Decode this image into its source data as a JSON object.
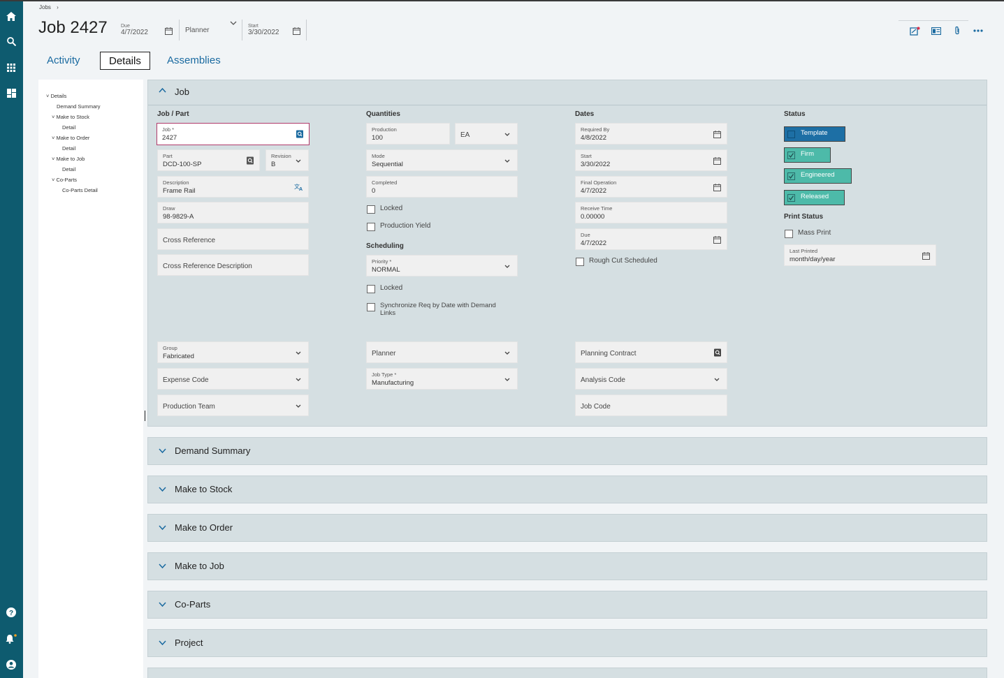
{
  "breadcrumb": {
    "root": "Jobs",
    "separator": "›"
  },
  "header": {
    "title": "Job 2427",
    "due_label": "Due",
    "due_value": "4/7/2022",
    "planner_label": "Planner",
    "start_label": "Start",
    "start_value": "3/30/2022"
  },
  "tabs": [
    {
      "label": "Activity"
    },
    {
      "label": "Details"
    },
    {
      "label": "Assemblies"
    }
  ],
  "tree": {
    "details": "Details",
    "demand_summary": "Demand Summary",
    "make_to_stock": "Make to Stock",
    "mts_detail": "Detail",
    "make_to_order": "Make to Order",
    "mto_detail": "Detail",
    "make_to_job": "Make to Job",
    "mtj_detail": "Detail",
    "co_parts": "Co-Parts",
    "co_parts_detail": "Co-Parts Detail"
  },
  "job_panel": {
    "title": "Job",
    "job_part": {
      "heading": "Job / Part",
      "job_label": "Job *",
      "job_value": "2427",
      "part_label": "Part",
      "part_value": "DCD-100-SP",
      "revision_label": "Revision",
      "revision_value": "B",
      "description_label": "Description",
      "description_value": "Frame Rail",
      "draw_label": "Draw",
      "draw_value": "98-9829-A",
      "cross_ref": "Cross Reference",
      "cross_ref_desc": "Cross Reference Description",
      "group_label": "Group",
      "group_value": "Fabricated",
      "expense_code": "Expense Code",
      "production_team": "Production Team"
    },
    "quantities": {
      "heading": "Quantities",
      "production_label": "Production",
      "production_value": "100",
      "uom_value": "EA",
      "mode_label": "Mode",
      "mode_value": "Sequential",
      "completed_label": "Completed",
      "completed_value": "0",
      "locked": "Locked",
      "production_yield": "Production Yield",
      "scheduling_heading": "Scheduling",
      "priority_label": "Priority *",
      "priority_value": "NORMAL",
      "sched_locked": "Locked",
      "sync_req": "Synchronize Req by Date with Demand Links",
      "planner": "Planner",
      "job_type_label": "Job Type *",
      "job_type_value": "Manufacturing"
    },
    "dates": {
      "heading": "Dates",
      "required_by_label": "Required By",
      "required_by_value": "4/8/2022",
      "start_label": "Start",
      "start_value": "3/30/2022",
      "final_op_label": "Final Operation",
      "final_op_value": "4/7/2022",
      "receive_time_label": "Receive Time",
      "receive_time_value": "0.00000",
      "due_label": "Due",
      "due_value": "4/7/2022",
      "rough_cut": "Rough Cut Scheduled",
      "planning_contract": "Planning Contract",
      "analysis_code": "Analysis Code",
      "job_code": "Job Code"
    },
    "status": {
      "heading": "Status",
      "template": "Template",
      "firm": "Firm",
      "engineered": "Engineered",
      "released": "Released",
      "print_heading": "Print Status",
      "mass_print": "Mass Print",
      "last_printed_label": "Last Printed",
      "last_printed_value": "month/day/year"
    }
  },
  "sections": [
    {
      "title": "Demand Summary"
    },
    {
      "title": "Make to Stock"
    },
    {
      "title": "Make to Order"
    },
    {
      "title": "Make to Job"
    },
    {
      "title": "Co-Parts"
    },
    {
      "title": "Project"
    }
  ],
  "colors": {
    "nav": "#0e5b6f",
    "template_badge": "#1d6fa5",
    "status_badge": "#4dbaa9",
    "panel": "#d5dfe2"
  }
}
